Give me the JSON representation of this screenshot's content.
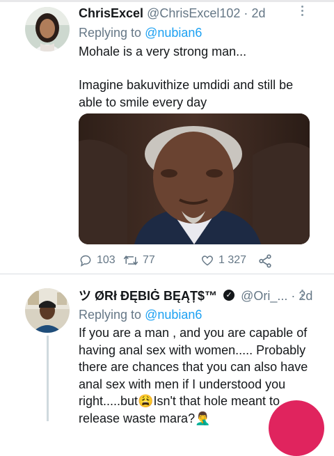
{
  "tweets": [
    {
      "display_name": "ChrisExcel",
      "handle": "@ChrisExcel102",
      "separator": "·",
      "time": "2d",
      "replying_prefix": "Replying to",
      "replying_to": "@nubian6",
      "text_line1": "Mohale is a very strong man...",
      "text_line2": "Imagine bakuvithize umdidi and still be able to smile every day",
      "counts": {
        "replies": "103",
        "retweets": "77",
        "likes": "1 327"
      }
    },
    {
      "display_name": "ツ ØRł ĐĘBIĠ BĘĄȚ$™",
      "handle": "@Ori_...",
      "separator": "·",
      "time": "2d",
      "replying_prefix": "Replying to",
      "replying_to": "@nubian6",
      "text": "If you are a man , and you are capable of having anal sex with women..... Probably there are chances that you can also have anal sex with men if I understood you right.....but😩Isn't that hole meant to release waste mara?🤦‍♂️"
    }
  ],
  "colors": {
    "link": "#1da1f2",
    "secondary_text": "#657786",
    "fab": "#e0245e"
  },
  "icons": [
    "reply-icon",
    "retweet-icon",
    "like-icon",
    "share-icon",
    "more-icon",
    "verified-icon"
  ]
}
